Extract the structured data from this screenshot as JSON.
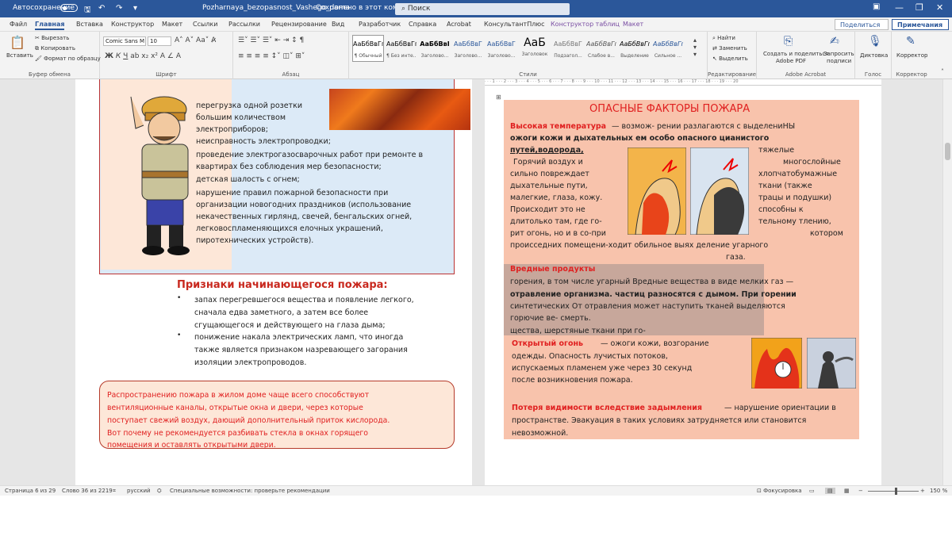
{
  "titlebar": {
    "autosave": "Автосохранение",
    "doc_title": "Pozharnaya_bezopasnost_Vashego_doma",
    "saved": "Сохранено в этот компьютер",
    "search": "Поиск"
  },
  "tabs": [
    "Файл",
    "Главная",
    "Вставка",
    "Конструктор",
    "Макет",
    "Ссылки",
    "Рассылки",
    "Рецензирование",
    "Вид",
    "Разработчик",
    "Справка",
    "Acrobat",
    "КонсультантПлюс",
    "Конструктор таблиц",
    "Макет"
  ],
  "share": "Поделиться",
  "comments": "Примечания",
  "ribbon": {
    "paste": "Вставить",
    "cut": "Вырезать",
    "copy": "Копировать",
    "format_painter": "Формат по образцу",
    "clipboard": "Буфер обмена",
    "font_name": "Comic Sans M",
    "font_size": "10",
    "font_group": "Шрифт",
    "paragraph_group": "Абзац",
    "styles_group": "Стили",
    "styles": [
      {
        "sample": "АаБбВвГг,",
        "name": "¶ Обычный"
      },
      {
        "sample": "АаБбВвГг,",
        "name": "¶ Без инте..."
      },
      {
        "sample": "АаБбВвI",
        "name": "Заголово..."
      },
      {
        "sample": "АаБбВвГ",
        "name": "Заголово..."
      },
      {
        "sample": "АаБбВвГ",
        "name": "Заголово..."
      },
      {
        "sample": "АаБ",
        "name": "Заголовок"
      },
      {
        "sample": "АаБбВвГ",
        "name": "Подзагол..."
      },
      {
        "sample": "АаБбВвГг",
        "name": "Слабое в..."
      },
      {
        "sample": "АаБбВвГг",
        "name": "Выделение"
      },
      {
        "sample": "АаБбВвГг",
        "name": "Сильное ..."
      }
    ],
    "find": "Найти",
    "replace": "Заменить",
    "select": "Выделить",
    "editing": "Редактирование",
    "acrobat1": "Создать и поделиться",
    "acrobat1b": "Adobe PDF",
    "acrobat2": "Запросить",
    "acrobat2b": "подписи",
    "acrobat_group": "Adobe Acrobat",
    "dictate": "Диктовка",
    "voice": "Голос",
    "editor": "Корректор",
    "editor_group": "Корректор"
  },
  "left": {
    "list1": [
      "перегрузка одной розетки",
      "большим количеством",
      "электроприборов;",
      "неисправность электропроводки;",
      "проведение электрогазосварочных работ при ремонте в",
      "квартирах без соблюдения мер безопасности;",
      "детская шалость с огнем;",
      "нарушение правил пожарной безопасности при",
      "организации новогодних праздников (использование",
      "некачественных гирлянд, свечей, бенгальских огней,",
      "легковоспламеняющихся елочных украшений,",
      "пиротехнических устройств)."
    ],
    "heading": "Признаки начинающегося пожара:",
    "signs": [
      "запах перегревшегося вещества и появление легкого,",
      "сначала едва заметного, а затем все более",
      "сгущающегося и действующего на глаза дыма;",
      "понижение накала электрических ламп, что иногда",
      "также является признаком назревающего загорания",
      "изоляции электропроводов."
    ],
    "note": [
      "Распространению пожара в жилом доме чаще всего способствуют",
      "вентиляционные каналы, открытые окна и двери, через которые",
      "поступает свежий воздух, дающий дополнительный приток кислорода.",
      "Вот почему не рекомендуется разбивать стекла в окнах горящего",
      "помещения и оставлять открытыми двери."
    ]
  },
  "right": {
    "title": "ОПАСНЫЕ ФАКТОРЫ ПОЖАРА",
    "ht_label": "Высокая температура",
    "ht_lines": [
      "— возмож-  рении разлагаются с выделениНЫ",
      "ожоги кожи и дыхательных  ем особо опасного цианистого",
      "путей,водорода,",
      "тяжелые",
      "Горячий воздух и",
      "многослойные",
      "сильно повреждает",
      "хлопчатобумажные",
      "дыхательные пути,",
      "ткани (также",
      "малегкие, глаза, кожу.",
      "трацы и подушки)",
      "Происходит это не",
      "способны к",
      "длитолько там, где го-",
      "тельному тлению,",
      "рит огонь, но и в со-при",
      "котором",
      "проиcседних помещени-ходит обильное выях деление угарного",
      "газа."
    ],
    "harm_title": "Вредные продукты",
    "harm_lines": [
      "горения, в том числе угарный Вредные вещества в виде мелких газ —",
      "отравление организма. частиц разносятся с дымом. При горении",
      "синтетических От отравления может наступить тканей выделяются",
      "горючие ве- смерть.",
      "щества, шерстяные ткани при го-"
    ],
    "fire_label": "Открытый огонь",
    "fire_lines": [
      "— ожоги кожи, возгорание",
      "одежды. Опасность лучистых потоков,",
      "испускаемых пламенем уже через 30 секунд",
      "после возникновения пожара."
    ],
    "vis_label": "Потеря видимости вследствие задымления",
    "vis_lines": [
      "— нарушение ориентации в",
      "пространстве. Эвакуация в таких условиях затрудняется или становится",
      "невозможной."
    ]
  },
  "status": {
    "page": "Страница 6 из 29",
    "words": "Слово 36 из 2219",
    "lang": "русский",
    "access": "Специальные возможности: проверьте рекомендации",
    "focus": "Фокусировка",
    "zoom": "150 %"
  }
}
